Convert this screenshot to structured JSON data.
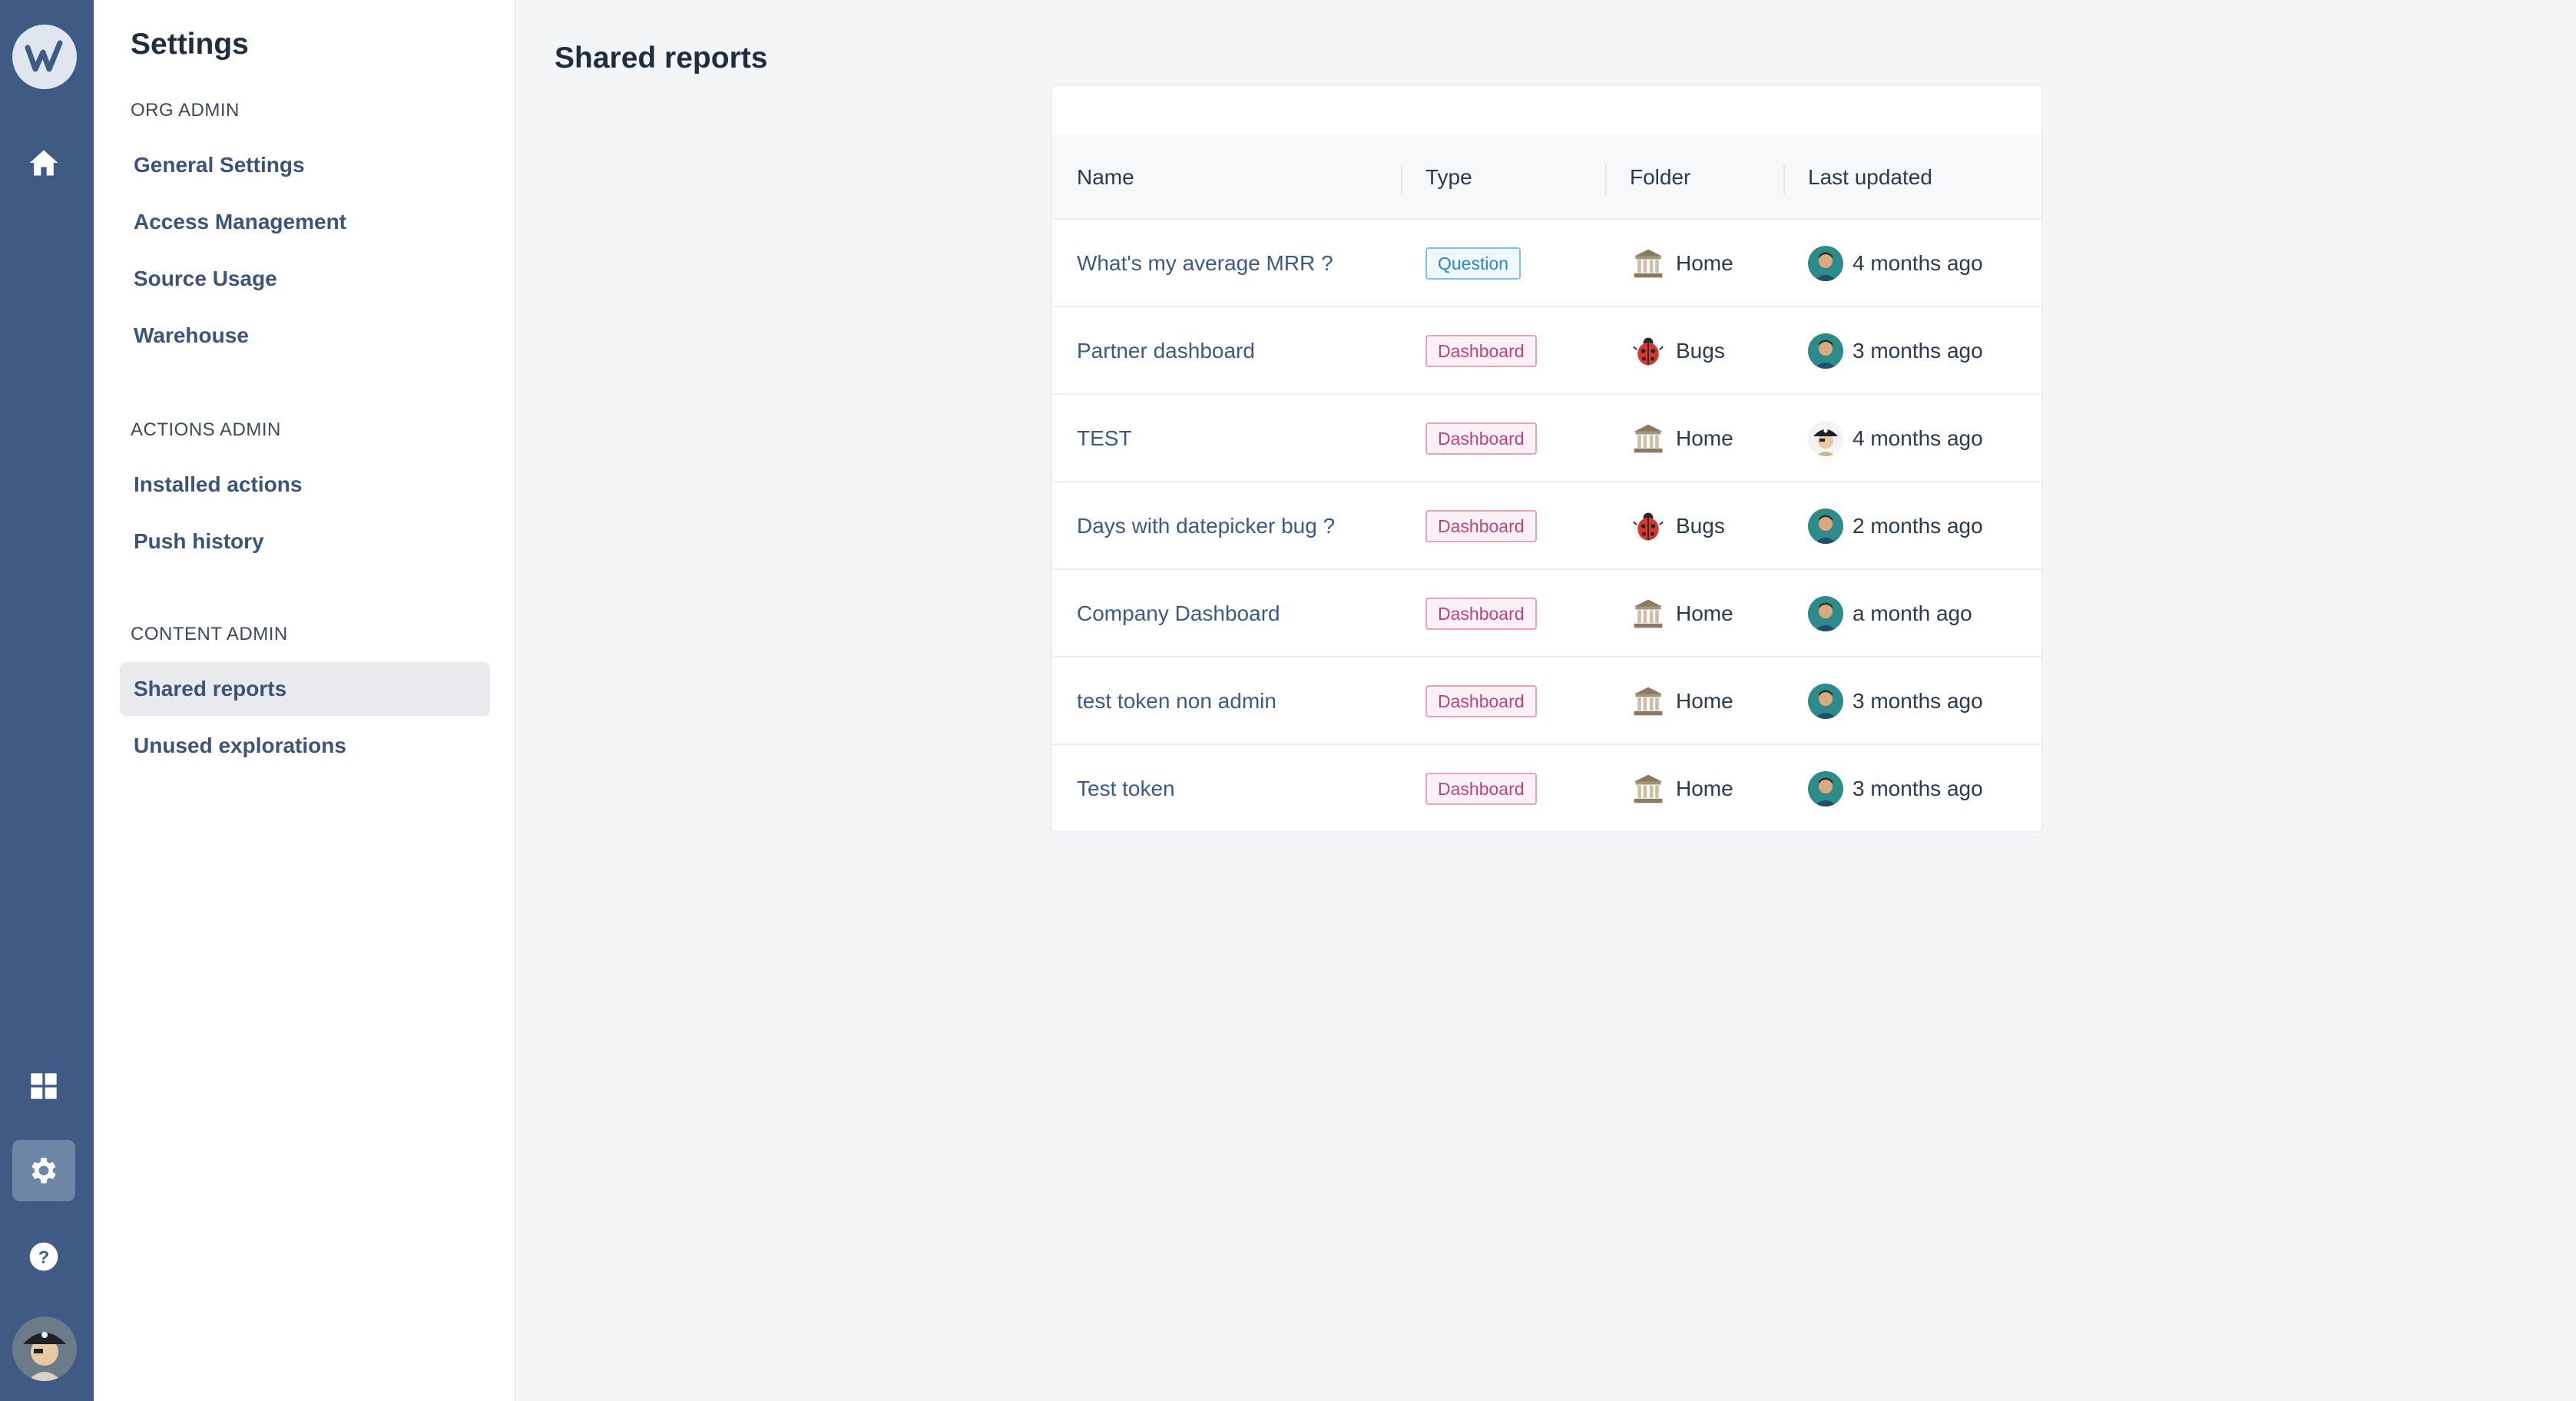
{
  "rail": {
    "logo_letter": "w",
    "items": [
      {
        "name": "home-icon"
      },
      {
        "name": "grid-icon"
      },
      {
        "name": "gear-icon",
        "active": true
      },
      {
        "name": "help-icon"
      }
    ],
    "accent": "#3f5b85"
  },
  "sidebar": {
    "title": "Settings",
    "sections": [
      {
        "label": "ORG ADMIN",
        "items": [
          "General Settings",
          "Access Management",
          "Source Usage",
          "Warehouse"
        ]
      },
      {
        "label": "ACTIONS ADMIN",
        "items": [
          "Installed actions",
          "Push history"
        ]
      },
      {
        "label": "CONTENT ADMIN",
        "items": [
          "Shared reports",
          "Unused explorations"
        ]
      }
    ],
    "selected": "Shared reports"
  },
  "main": {
    "title": "Shared reports",
    "columns": [
      "Name",
      "Type",
      "Folder",
      "Last updated"
    ],
    "rows": [
      {
        "name": "What's my average MRR ?",
        "type": "Question",
        "folder": "Home",
        "folder_icon": "museum-icon",
        "updated": "4 months ago",
        "avatar": "user-avatar"
      },
      {
        "name": "Partner dashboard",
        "type": "Dashboard",
        "folder": "Bugs",
        "folder_icon": "ladybug-icon",
        "updated": "3 months ago",
        "avatar": "user-avatar"
      },
      {
        "name": "TEST",
        "type": "Dashboard",
        "folder": "Home",
        "folder_icon": "museum-icon",
        "updated": "4 months ago",
        "avatar": "pirate-avatar"
      },
      {
        "name": "Days with datepicker bug ?",
        "type": "Dashboard",
        "folder": "Bugs",
        "folder_icon": "ladybug-icon",
        "updated": "2 months ago",
        "avatar": "user-avatar"
      },
      {
        "name": "Company Dashboard",
        "type": "Dashboard",
        "folder": "Home",
        "folder_icon": "museum-icon",
        "updated": "a month ago",
        "avatar": "user-avatar"
      },
      {
        "name": "test token non admin",
        "type": "Dashboard",
        "folder": "Home",
        "folder_icon": "museum-icon",
        "updated": "3 months ago",
        "avatar": "user-avatar"
      },
      {
        "name": "Test token",
        "type": "Dashboard",
        "folder": "Home",
        "folder_icon": "museum-icon",
        "updated": "3 months ago",
        "avatar": "user-avatar"
      }
    ]
  }
}
